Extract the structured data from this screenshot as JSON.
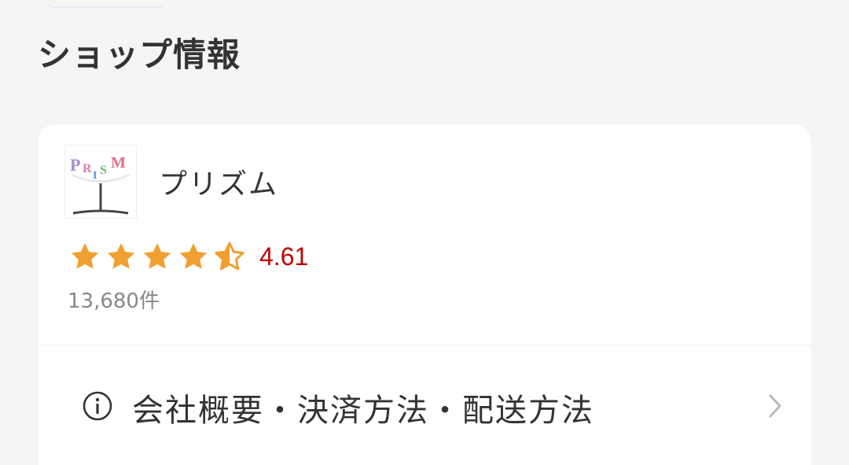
{
  "section": {
    "title": "ショップ情報"
  },
  "shop": {
    "name": "プリズム",
    "logo_text": "PRISM",
    "rating": {
      "value": "4.61",
      "stars_filled": 4,
      "stars_half": 1,
      "stars_total": 5,
      "star_color": "#f0a030",
      "value_color": "#bf0000"
    },
    "review_count": "13,680件"
  },
  "info_link": {
    "label": "会社概要・決済方法・配送方法",
    "icon": "info-circle-icon",
    "chevron": "chevron-right-icon"
  }
}
